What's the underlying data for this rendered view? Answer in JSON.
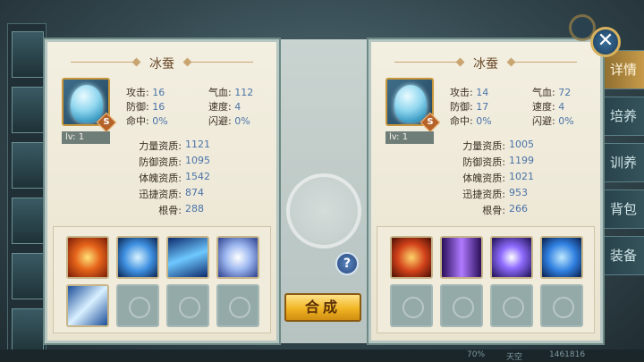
{
  "background": {
    "tabs": [
      "详情",
      "培养",
      "训养",
      "背包",
      "装备"
    ],
    "bottom": {
      "left": "70%",
      "mid": "天空",
      "right": "1461816"
    }
  },
  "left_pet": {
    "name": "冰蚕",
    "rank_badge": "S",
    "level": "lv: 1",
    "stats": {
      "attack_label": "攻击:",
      "attack": "16",
      "hp_label": "气血:",
      "hp": "112",
      "defense_label": "防御:",
      "defense": "16",
      "speed_label": "速度:",
      "speed": "4",
      "hit_label": "命中:",
      "hit": "0%",
      "dodge_label": "闪避:",
      "dodge": "0%"
    },
    "aptitudes": [
      {
        "label": "力量资质:",
        "value": "1121"
      },
      {
        "label": "防御资质:",
        "value": "1095"
      },
      {
        "label": "体魄资质:",
        "value": "1542"
      },
      {
        "label": "迅捷资质:",
        "value": "874"
      },
      {
        "label": "根骨:",
        "value": "288"
      }
    ],
    "skills": [
      "fire-burst-skill-icon",
      "water-heart-skill-icon",
      "wind-slash-skill-icon",
      "spiral-orb-skill-icon",
      "blue-blade-skill-icon",
      "empty",
      "empty",
      "empty"
    ]
  },
  "right_pet": {
    "name": "冰蚕",
    "rank_badge": "S",
    "level": "lv: 1",
    "stats": {
      "attack_label": "攻击:",
      "attack": "14",
      "hp_label": "气血:",
      "hp": "72",
      "defense_label": "防御:",
      "defense": "17",
      "speed_label": "速度:",
      "speed": "4",
      "hit_label": "命中:",
      "hit": "0%",
      "dodge_label": "闪避:",
      "dodge": "0%"
    },
    "aptitudes": [
      {
        "label": "力量资质:",
        "value": "1005"
      },
      {
        "label": "防御资质:",
        "value": "1199"
      },
      {
        "label": "体魄资质:",
        "value": "1021"
      },
      {
        "label": "迅捷资质:",
        "value": "953"
      },
      {
        "label": "根骨:",
        "value": "266"
      }
    ],
    "skills": [
      "fire-ring-skill-icon",
      "purple-pillar-skill-icon",
      "violet-orb-skill-icon",
      "blue-beast-skill-icon",
      "empty",
      "empty",
      "empty",
      "empty"
    ]
  },
  "buttons": {
    "help": "?",
    "combine": "合成",
    "close": "✕"
  },
  "colors": {
    "panel_bg": "#f3efe1",
    "value_blue": "#4a73a8",
    "gold_button": "#f0b523"
  }
}
